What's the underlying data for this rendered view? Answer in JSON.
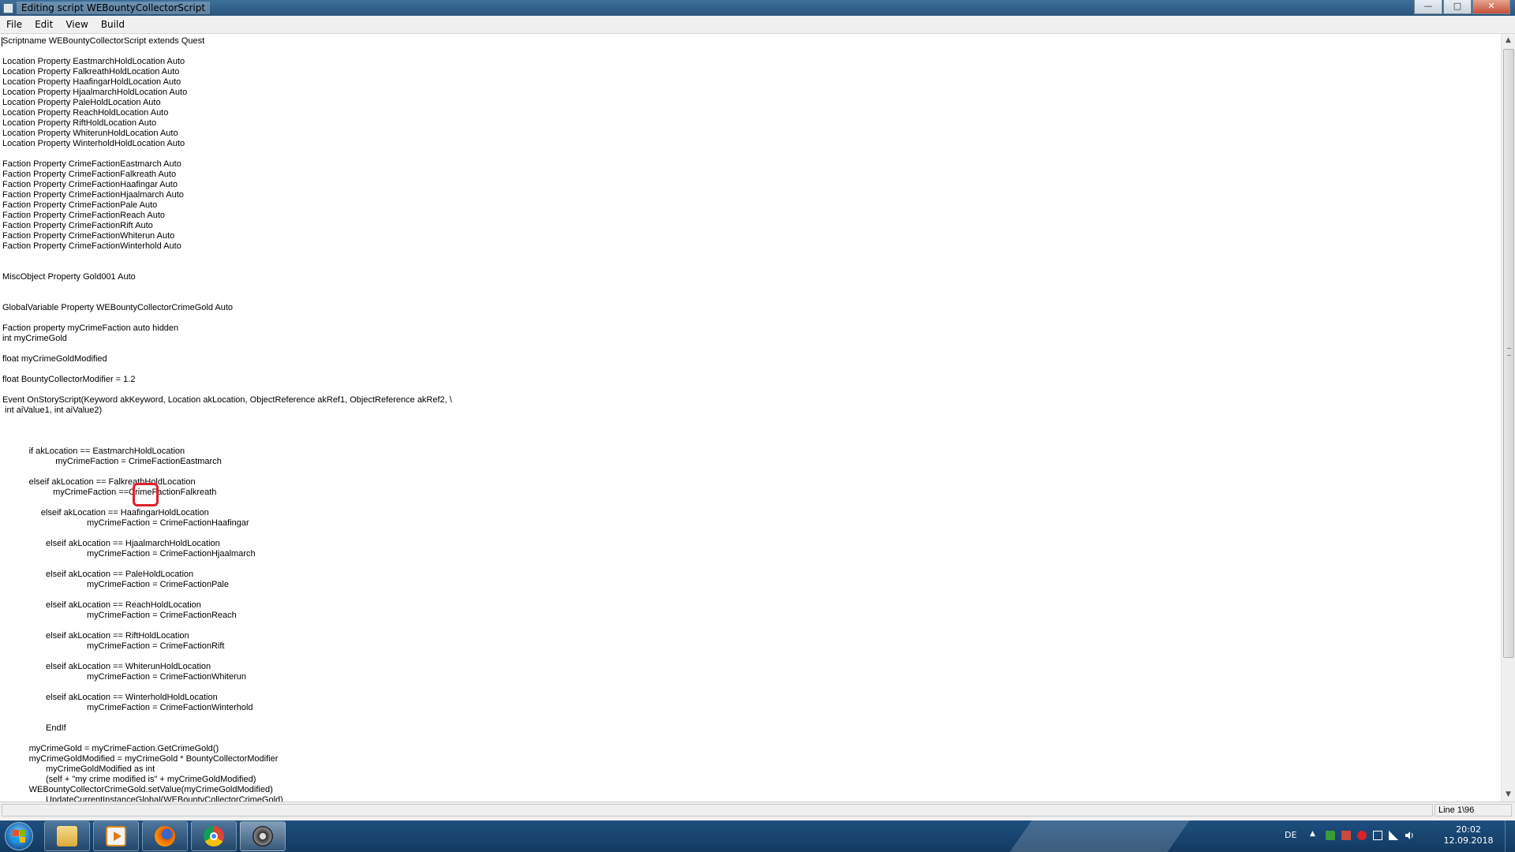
{
  "window": {
    "title": "Editing script WEBountyCollectorScript",
    "minimize_glyph": "—",
    "maximize_glyph": "□",
    "close_glyph": "✕"
  },
  "menu": [
    "File",
    "Edit",
    "View",
    "Build"
  ],
  "editor": {
    "lines": [
      "Scriptname WEBountyCollectorScript extends Quest",
      "",
      "Location Property EastmarchHoldLocation Auto",
      "Location Property FalkreathHoldLocation Auto",
      "Location Property HaafingarHoldLocation Auto",
      "Location Property HjaalmarchHoldLocation Auto",
      "Location Property PaleHoldLocation Auto",
      "Location Property ReachHoldLocation Auto",
      "Location Property RiftHoldLocation Auto",
      "Location Property WhiterunHoldLocation Auto",
      "Location Property WinterholdHoldLocation Auto",
      "",
      "Faction Property CrimeFactionEastmarch Auto",
      "Faction Property CrimeFactionFalkreath Auto",
      "Faction Property CrimeFactionHaafingar Auto",
      "Faction Property CrimeFactionHjaalmarch Auto",
      "Faction Property CrimeFactionPale Auto",
      "Faction Property CrimeFactionReach Auto",
      "Faction Property CrimeFactionRift Auto",
      "Faction Property CrimeFactionWhiterun Auto",
      "Faction Property CrimeFactionWinterhold Auto",
      "",
      "",
      "MiscObject Property Gold001 Auto",
      "",
      "",
      "GlobalVariable Property WEBountyCollectorCrimeGold Auto",
      "",
      "Faction property myCrimeFaction auto hidden",
      "int myCrimeGold",
      "",
      "float myCrimeGoldModified",
      "",
      "float BountyCollectorModifier = 1.2",
      "",
      "Event OnStoryScript(Keyword akKeyword, Location akLocation, ObjectReference akRef1, ObjectReference akRef2, \\",
      " int aiValue1, int aiValue2)",
      "",
      "",
      "",
      "           if akLocation == EastmarchHoldLocation",
      "                      myCrimeFaction = CrimeFactionEastmarch",
      "",
      "           elseif akLocation == FalkreathHoldLocation",
      "                     myCrimeFaction ==CrimeFactionFalkreath",
      "",
      "                elseif akLocation == HaafingarHoldLocation",
      "                                   myCrimeFaction = CrimeFactionHaafingar",
      "",
      "                  elseif akLocation == HjaalmarchHoldLocation",
      "                                   myCrimeFaction = CrimeFactionHjaalmarch",
      "",
      "                  elseif akLocation == PaleHoldLocation",
      "                                   myCrimeFaction = CrimeFactionPale",
      "",
      "                  elseif akLocation == ReachHoldLocation",
      "                                   myCrimeFaction = CrimeFactionReach",
      "",
      "                  elseif akLocation == RiftHoldLocation",
      "                                   myCrimeFaction = CrimeFactionRift",
      "",
      "                  elseif akLocation == WhiterunHoldLocation",
      "                                   myCrimeFaction = CrimeFactionWhiterun",
      "",
      "                  elseif akLocation == WinterholdHoldLocation",
      "                                   myCrimeFaction = CrimeFactionWinterhold",
      "",
      "                  EndIf",
      "",
      "           myCrimeGold = myCrimeFaction.GetCrimeGold()",
      "           myCrimeGoldModified = myCrimeGold * BountyCollectorModifier",
      "                  myCrimeGoldModified as int",
      "                  (self + \"my crime modified is\" + myCrimeGoldModified)",
      "           WEBountyCollectorCrimeGold.setValue(myCrimeGoldModified)",
      "                  UpdateCurrentInstanceGlobal(WEBountyCollectorCrimeGold)"
    ]
  },
  "statusbar": {
    "message": "",
    "position": "Line 1\\96"
  },
  "taskbar": {
    "apps": [
      {
        "icon": "folder-icon"
      },
      {
        "icon": "media-player-icon"
      },
      {
        "icon": "firefox-icon"
      },
      {
        "icon": "chrome-icon"
      },
      {
        "icon": "creation-kit-icon"
      }
    ],
    "tray": {
      "language": "DE",
      "time": "20:02",
      "date": "12.09.2018"
    }
  }
}
